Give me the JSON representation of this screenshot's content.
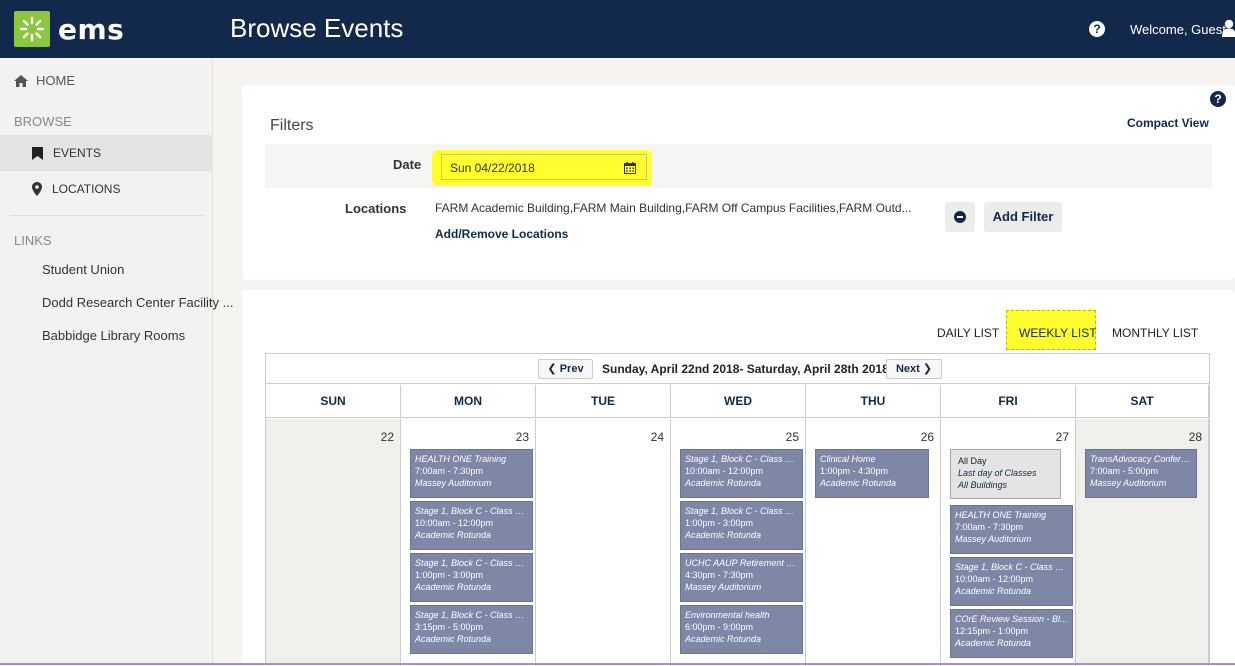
{
  "header": {
    "logo_text": "ems",
    "title": "Browse Events",
    "welcome": "Welcome, Guest.",
    "help": "?"
  },
  "sidebar": {
    "home": "HOME",
    "browse_section": "BROWSE",
    "browse_items": [
      "EVENTS",
      "LOCATIONS"
    ],
    "links_section": "LINKS",
    "links": [
      "Student Union",
      "Dodd Research Center Facility ...",
      "Babbidge Library Rooms"
    ]
  },
  "filters": {
    "title": "Filters",
    "compact_view": "Compact View",
    "date_label": "Date",
    "date_value": "Sun 04/22/2018",
    "locations_label": "Locations",
    "locations_value": "FARM Academic Building,FARM Main Building,FARM Off Campus Facilities,FARM Outd...",
    "add_remove_locations": "Add/Remove Locations",
    "add_filter": "Add Filter"
  },
  "calendar": {
    "views": [
      "DAILY LIST",
      "WEEKLY LIST",
      "MONTHLY LIST"
    ],
    "active_view": "WEEKLY LIST",
    "prev": "Prev",
    "next": "Next",
    "range": "Sunday, April 22nd 2018- Saturday, April 28th 2018",
    "days": [
      {
        "name": "SUN",
        "date": "22",
        "events": []
      },
      {
        "name": "MON",
        "date": "23",
        "events": [
          {
            "title": "HEALTH ONE Training",
            "time": "7:00am - 7:30pm",
            "location": "Massey Auditorium"
          },
          {
            "title": "Stage 1, Block C - Class 2 ...",
            "time": "10:00am - 12:00pm",
            "location": "Academic Rotunda"
          },
          {
            "title": "Stage 1, Block C - Class 2 ...",
            "time": "1:00pm - 3:00pm",
            "location": "Academic Rotunda"
          },
          {
            "title": "Stage 1, Block C - Class 2 ...",
            "time": "3:15pm - 5:00pm",
            "location": "Academic Rotunda"
          }
        ]
      },
      {
        "name": "TUE",
        "date": "24",
        "events": []
      },
      {
        "name": "WED",
        "date": "25",
        "events": [
          {
            "title": "Stage 1, Block C - Class 2 ...",
            "time": "10:00am - 12:00pm",
            "location": "Academic Rotunda"
          },
          {
            "title": "Stage 1, Block C - Class 2 ...",
            "time": "1:00pm - 3:00pm",
            "location": "Academic Rotunda"
          },
          {
            "title": "UCHC AAUP Retirement S...",
            "time": "4:30pm - 7:30pm",
            "location": "Massey Auditorium"
          },
          {
            "title": "Environmental health",
            "time": "6:00pm - 9:00pm",
            "location": "Academic Rotunda"
          }
        ]
      },
      {
        "name": "THU",
        "date": "26",
        "events": [
          {
            "title": "Clinical Home",
            "time": "1:00pm - 4:30pm",
            "location": "Academic Rotunda"
          }
        ]
      },
      {
        "name": "FRI",
        "date": "27",
        "allday": {
          "label": "All Day",
          "title": "Last day of Classes",
          "location": "All Buildings"
        },
        "events": [
          {
            "title": "HEALTH ONE Training",
            "time": "7:00am - 7:30pm",
            "location": "Massey Auditorium"
          },
          {
            "title": "Stage 1, Block C - Class 2 ...",
            "time": "10:00am - 12:00pm",
            "location": "Academic Rotunda"
          },
          {
            "title": "COrE Review Session - Bl...",
            "time": "12:15pm - 1:00pm",
            "location": "Academic Rotunda"
          }
        ]
      },
      {
        "name": "SAT",
        "date": "28",
        "events": [
          {
            "title": "TransAdvocacy Conference",
            "time": "7:00am - 5:00pm",
            "location": "Massey Auditorium"
          }
        ]
      }
    ]
  },
  "colors": {
    "header_bg": "#13294b",
    "logo_green": "#8dc63f",
    "highlight": "#ffff2e",
    "event_bg": "#7e88a6"
  }
}
